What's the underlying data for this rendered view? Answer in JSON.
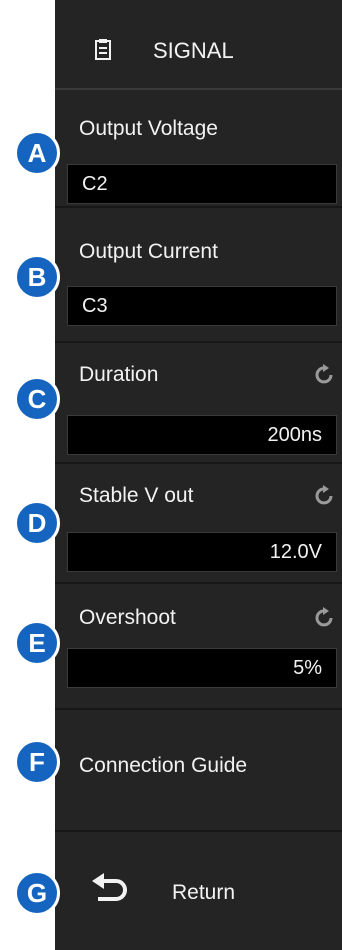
{
  "header": {
    "icon": "clipboard-icon",
    "title": "SIGNAL"
  },
  "items": [
    {
      "key": "A",
      "label": "Output Voltage",
      "value": "C2"
    },
    {
      "key": "B",
      "label": "Output Current",
      "value": "C3"
    },
    {
      "key": "C",
      "label": "Duration",
      "value": "200ns",
      "reset_icon": "reset-icon"
    },
    {
      "key": "D",
      "label": "Stable V out",
      "value": "12.0V",
      "reset_icon": "reset-icon"
    },
    {
      "key": "E",
      "label": "Overshoot",
      "value": "5%",
      "reset_icon": "reset-icon"
    },
    {
      "key": "F",
      "label": "Connection Guide"
    },
    {
      "key": "G",
      "label": "Return",
      "icon": "return-arrow-icon"
    }
  ],
  "colors": {
    "panel": "#242424",
    "field": "#000000",
    "text": "#f2f2f2",
    "badge": "#1565c0"
  }
}
